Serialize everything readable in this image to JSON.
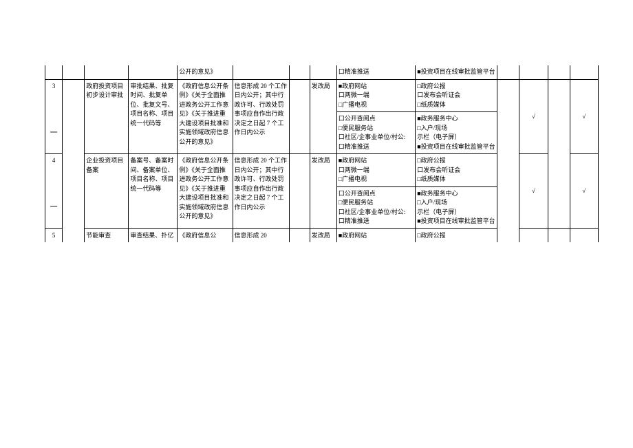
{
  "rows": {
    "r0": {
      "basis": "公开的意见》",
      "channel_left": "口精准推送",
      "channel_right": "■投资项目在线审批监管平台"
    },
    "r3": {
      "num": "3",
      "num_sub": "一",
      "name": "政府投资项目初步设计审批",
      "content": "审批结果、批复时间、批复单位、批复文号、项目名称、项目统一代码等",
      "basis": "《政府信息公开条例》《关于全面推进政务公开工作意\n见》《关于推进重大建设项目批准和实施领域政府信息公开的意见》",
      "timing": "信息形成 20 个工作日内公开；其中行政许可、行政处罚事项应自作出行政决定之日起 7 个工作日内公示",
      "dept": "发改局",
      "ch_left_a": "■政府网站\n口两微一端\n□广播电视",
      "ch_left_b": "口公开查阅点\n□便民服务站\n口社区/企事业单位/村公:\n口精准推送",
      "ch_right_a": "□政府公报\n口发布会听证会\n□纸质媒体",
      "ch_right_b": "■政务服务中心\n□入户/现场\n示栏（电子屏）\n■投资项目在线审批监管平台",
      "check1": "√",
      "check2": "√",
      "dash": "—"
    },
    "r4": {
      "num": "4",
      "num_sub": "一",
      "name": "企业投资项目备案",
      "content": "备案号、备案时间、备案单位、项目名称、项目统一代码等",
      "basis": "《政府信息公开条例》《关于全面推进政务公开工作意\n见》《关于推进重大建设项目批准和实施领域政府信息公开的意见》",
      "timing": "信息形成 20 个工作日内公开；其中行政许可、行政处罚事项应自作出行政决定之日起 7 个工作日内公示",
      "dept": "发改局",
      "ch_left_a": "■政府网站\n口两微一端\n□广播电视",
      "ch_left_b": "口公开查阅点\n□便民服务站\n口社区/企事业单位/村公:\n口精准推送",
      "ch_right_a": "□政府公报\n口发布会听证会\n□纸质媒体",
      "ch_right_b": "■政务服务中心\n□入户/现场\n示栏（电子屏）\n■投资项目在线审批监管平台",
      "check1": "√",
      "check2": "√",
      "dash": "—"
    },
    "r5": {
      "num": "5",
      "name": "节能审查",
      "content": "审查结果、扑亿",
      "basis": "《政府信息公",
      "timing": "信息形成 20",
      "dept": "发改局",
      "ch_left": "■政府网站",
      "ch_right": "□政府公报"
    }
  }
}
